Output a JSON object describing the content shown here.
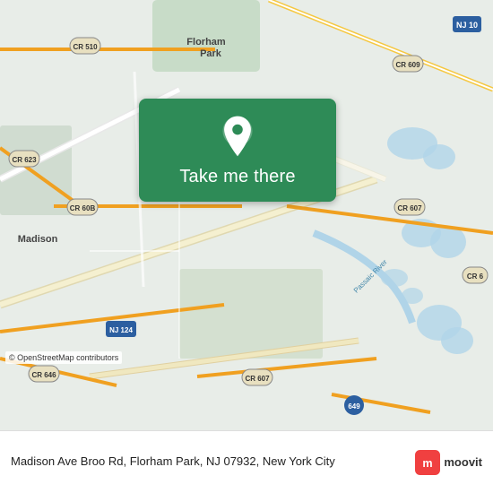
{
  "map": {
    "background_color": "#e8ede8",
    "center_lat": 40.78,
    "center_lng": -74.38
  },
  "location_card": {
    "button_label": "Take me there",
    "pin_icon": "location-pin-icon"
  },
  "bottom_bar": {
    "osm_attribution": "© OpenStreetMap contributors",
    "address": "Madison Ave Broo Rd, Florham Park, NJ 07932, New York City",
    "moovit_label": "moovit"
  },
  "road_labels": {
    "cr510": "CR 510",
    "nj10": "NJ 10",
    "cr609": "CR 609",
    "cr623": "CR 623",
    "cr608": "CR 60B",
    "cr607_top": "CR 607",
    "cr607_bot": "CR 607",
    "nj124": "NJ 124",
    "cr646": "CR 646",
    "madison": "Madison",
    "florham_park": "Florham Park",
    "passaic_river": "Passaic River",
    "route649": "649"
  }
}
